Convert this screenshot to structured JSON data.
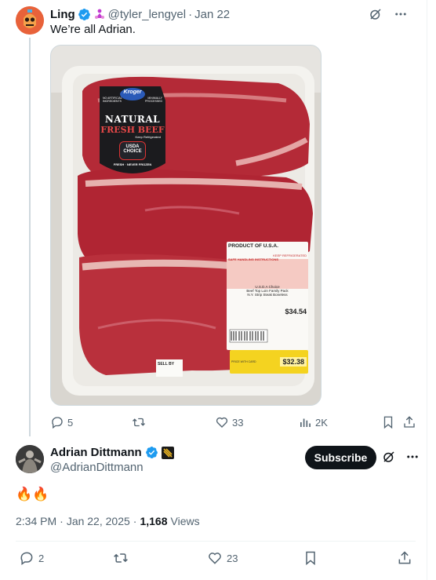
{
  "tweet1": {
    "author_name": "Ling",
    "handle": "@tyler_lengyel",
    "separator": "·",
    "date": "Jan 22",
    "text": "We’re all Adrian.",
    "image": {
      "label_brand": "Kroger",
      "label_line1": "NATURAL",
      "label_line2": "FRESH BEEF",
      "label_keep": "Keep Refrigerated",
      "label_left_note": "NO ARTIFICIAL INGREDIENTS",
      "label_right_note": "MINIMALLY PROCESSED",
      "label_usda1": "USDA",
      "label_usda2": "CHOICE",
      "label_ring": "FRESH · NEVER FROZEN",
      "sticker_origin": "PRODUCT OF U.S.A.",
      "sticker_keep": "KEEP REFRIGERATED",
      "sticker_safe": "SAFE HANDLING INSTRUCTIONS",
      "sticker_grade": "U.S.D.A Choice",
      "sticker_desc1": "Beef Top Loin Family Pack",
      "sticker_desc2": "N.Y. Strip Steak Boneless",
      "sticker_price": "$34.54",
      "yellow_price": "$32.38",
      "yellow_small": "PRICE WITH CARD",
      "sell_by": "SELL BY"
    },
    "actions": {
      "replies": "5",
      "reposts": "",
      "likes": "33",
      "views": "2K"
    }
  },
  "tweet2": {
    "author_name": "Adrian Dittmann",
    "handle": "@AdrianDittmann",
    "subscribe_label": "Subscribe",
    "text": "🔥🔥",
    "time": "2:34 PM",
    "separator": "·",
    "date": "Jan 22, 2025",
    "separator2": "·",
    "views_count": "1,168",
    "views_label": "Views",
    "actions": {
      "replies": "2",
      "reposts": "",
      "likes": "23"
    }
  },
  "colors": {
    "verified": "#1d9bf0",
    "muted": "#536471",
    "affiliate": "#c13bd1"
  }
}
